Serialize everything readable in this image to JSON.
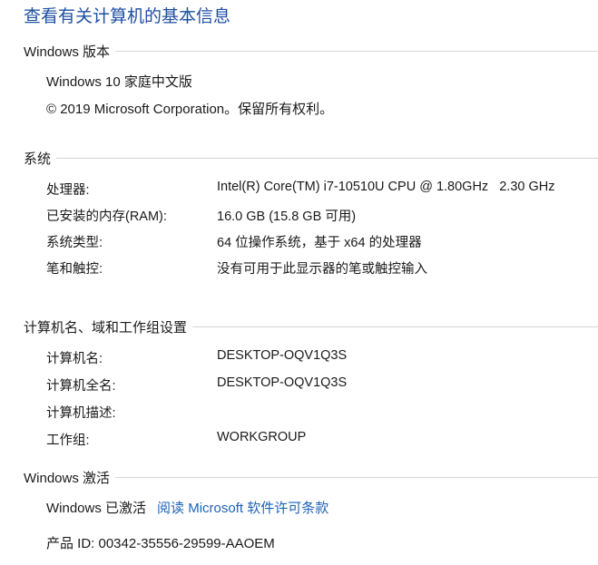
{
  "page_title": "查看有关计算机的基本信息",
  "windows_edition": {
    "header": "Windows 版本",
    "edition": "Windows 10 家庭中文版",
    "copyright": "© 2019 Microsoft Corporation。保留所有权利。"
  },
  "system": {
    "header": "系统",
    "rows": [
      {
        "key": "处理器:",
        "value": "Intel(R) Core(TM) i7-10510U CPU @ 1.80GHz   2.30 GHz"
      },
      {
        "key": "已安装的内存(RAM):",
        "value": "16.0 GB (15.8 GB 可用)"
      },
      {
        "key": "系统类型:",
        "value": "64 位操作系统，基于 x64 的处理器"
      },
      {
        "key": "笔和触控:",
        "value": "没有可用于此显示器的笔或触控输入"
      }
    ]
  },
  "computer_name": {
    "header": "计算机名、域和工作组设置",
    "rows": [
      {
        "key": "计算机名:",
        "value": "DESKTOP-OQV1Q3S"
      },
      {
        "key": "计算机全名:",
        "value": "DESKTOP-OQV1Q3S"
      },
      {
        "key": "计算机描述:",
        "value": ""
      },
      {
        "key": "工作组:",
        "value": "WORKGROUP"
      }
    ]
  },
  "activation": {
    "header": "Windows 激活",
    "status": "Windows 已激活",
    "license_link": "阅读 Microsoft 软件许可条款",
    "product_id": "产品 ID: 00342-35556-29599-AAOEM"
  }
}
